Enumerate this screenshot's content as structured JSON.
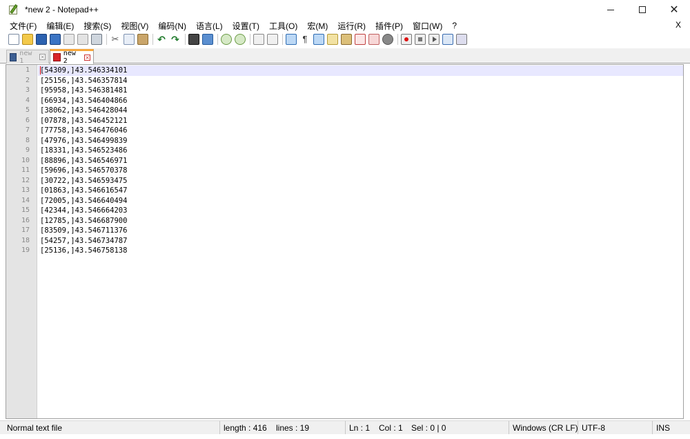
{
  "window": {
    "title": "*new 2 - Notepad++",
    "controls": {
      "minimize": "",
      "maximize": "",
      "close": "✕"
    }
  },
  "menu": {
    "items": [
      "文件(F)",
      "编辑(E)",
      "搜索(S)",
      "视图(V)",
      "编码(N)",
      "语言(L)",
      "设置(T)",
      "工具(O)",
      "宏(M)",
      "运行(R)",
      "插件(P)",
      "窗口(W)",
      "?"
    ],
    "close_label": "X"
  },
  "toolbar": {
    "icons": [
      "new-file-icon",
      "open-file-icon",
      "save-icon",
      "save-all-icon",
      "close-icon",
      "close-all-icon",
      "print-icon",
      "cut-icon",
      "copy-icon",
      "paste-icon",
      "undo-icon",
      "redo-icon",
      "find-icon",
      "replace-icon",
      "zoom-in-icon",
      "zoom-out-icon",
      "sync-vertical-icon",
      "sync-horizontal-icon",
      "word-wrap-icon",
      "show-all-characters-icon",
      "indent-guide-icon",
      "user-language-icon",
      "document-map-icon",
      "function-list-icon",
      "folder-workspace-icon",
      "monitoring-icon",
      "record-macro-icon",
      "stop-recording-icon",
      "playback-icon",
      "run-multiple-icon",
      "save-macro-icon"
    ]
  },
  "tabs": [
    {
      "label": "new 1",
      "active": false
    },
    {
      "label": "new 2",
      "active": true
    }
  ],
  "editor": {
    "lines": [
      {
        "num": "1",
        "text": "[54309,]43.546334101"
      },
      {
        "num": "2",
        "text": "[25156,]43.546357814"
      },
      {
        "num": "3",
        "text": "[95958,]43.546381481"
      },
      {
        "num": "4",
        "text": "[66934,]43.546404866"
      },
      {
        "num": "5",
        "text": "[38062,]43.546428044"
      },
      {
        "num": "6",
        "text": "[07878,]43.546452121"
      },
      {
        "num": "7",
        "text": "[77758,]43.546476046"
      },
      {
        "num": "8",
        "text": "[47976,]43.546499839"
      },
      {
        "num": "9",
        "text": "[18331,]43.546523486"
      },
      {
        "num": "10",
        "text": "[88896,]43.546546971"
      },
      {
        "num": "11",
        "text": "[59696,]43.546570378"
      },
      {
        "num": "12",
        "text": "[30722,]43.546593475"
      },
      {
        "num": "13",
        "text": "[01863,]43.546616547"
      },
      {
        "num": "14",
        "text": "[72005,]43.546640494"
      },
      {
        "num": "15",
        "text": "[42344,]43.546664203"
      },
      {
        "num": "16",
        "text": "[12785,]43.546687900"
      },
      {
        "num": "17",
        "text": "[83509,]43.546711376"
      },
      {
        "num": "18",
        "text": "[54257,]43.546734787"
      },
      {
        "num": "19",
        "text": "[25136,]43.546758138"
      }
    ]
  },
  "status": {
    "file_type": "Normal text file",
    "length": "length : 416",
    "lines": "lines : 19",
    "ln": "Ln : 1",
    "col": "Col : 1",
    "sel": "Sel : 0 | 0",
    "eol": "Windows (CR LF)",
    "encoding": "UTF-8",
    "mode": "INS"
  }
}
